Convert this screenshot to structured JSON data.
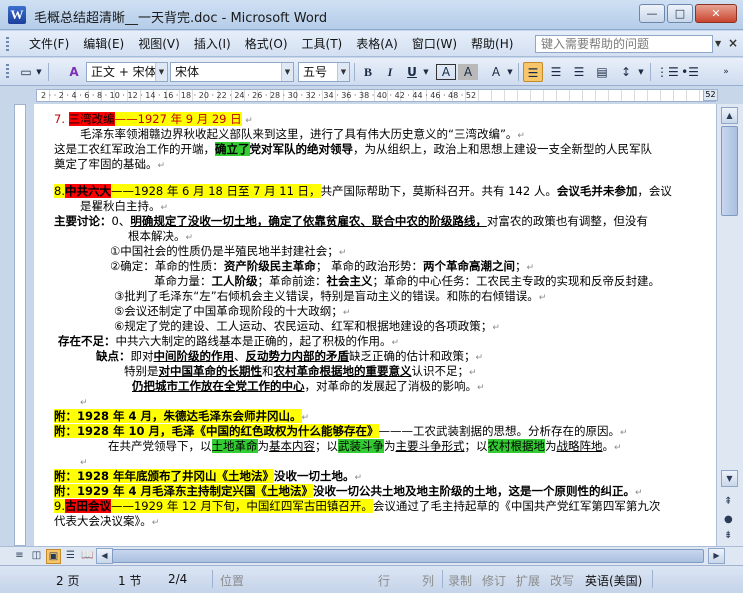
{
  "window": {
    "title": "毛概总结超清晰__一天背完.doc - Microsoft Word",
    "app_icon": "W",
    "minimize": "—",
    "maximize": "□",
    "close": "✕"
  },
  "menu": {
    "items": [
      "文件(F)",
      "编辑(E)",
      "视图(V)",
      "插入(I)",
      "格式(O)",
      "工具(T)",
      "表格(A)",
      "窗口(W)",
      "帮助(H)"
    ],
    "help_placeholder": "键入需要帮助的问题",
    "close_doc": "×"
  },
  "toolbar": {
    "style": "正文 + 宋体",
    "font": "宋体",
    "size": "五号",
    "bold": "B",
    "italic": "I",
    "underline": "U",
    "char_border": "A",
    "char_shade": "A",
    "aa": "A",
    "highlight": "ab"
  },
  "ruler": {
    "numbers": "2 · · 2 · 4 · 6 · 8 · 10 · 12 · 14 · 16 · 18 · 20 · 22 · 24 · 26 · 28 · 30 · 32 · 34 · 36 · 38 · 40 · 42 · 44 · 46 · 48 · 52",
    "end_mark": "52"
  },
  "document": {
    "p7_num": "7.",
    "p7_title": "三湾改编",
    "p7_date": "——1927 年 9 月 29 日",
    "p7_l2": "毛泽东率领湘赣边界秋收起义部队来到这里，进行了具有伟大历史意义的“三湾改编”。",
    "p7_l3a": "这是工农红军政治工作的开端，",
    "p7_l3b": "确立了",
    "p7_l3c": "党对军队的绝对领导",
    "p7_l3d": "，为从组织上，政治上和思想上建设一支全新型的人民军队",
    "p7_l4": "奠定了牢固的基础。",
    "p8_num": "8.",
    "p8_title": "中共六大",
    "p8_date": "——1928 年 6 月 18 日至 7 月 11 日，",
    "p8_rest": "共产国际帮助下，莫斯科召开。共有 142 人。",
    "p8_bold": "会议毛并未参加",
    "p8_end": "，会议",
    "p8_l2": "是瞿秋白主持。",
    "disc_label": "主要讨论：",
    "disc_1a": "0、",
    "disc_1b": "明确规定了没收一切土地，确定了依靠贫雇农、联合中农的阶级路线，",
    "disc_1c": "对富农的政策也有调整，但没有",
    "disc_2": "根本解决。",
    "i1": "①中国社会的性质仍是半殖民地半封建社会；",
    "i2a": "②确定：革命的性质：",
    "i2b": "资产阶级民主革命",
    "i2c": "；  革命的政治形势：",
    "i2d": "两个革命高潮之间",
    "i2e": "；",
    "i3a": "革命力量：",
    "i3b": "工人阶级",
    "i3c": "；革命前途：",
    "i3d": "社会主义",
    "i3e": "；革命的中心任务：工农民主专政的实现和反帝反封建。",
    "i4": "③批判了毛泽东“左”右倾机会主义错误，特别是盲动主义的错误。和陈的右倾错误。",
    "i5": "⑤会议还制定了中国革命现阶段的十大政纲；",
    "i6": "⑥规定了党的建设、工人运动、农民运动、红军和根据地建设的各项政策；",
    "ex_label": "存在不足：",
    "ex_text": "中共六大制定的路线基本是正确的，起了积极的作用。",
    "d_label": "缺点：",
    "d1a": "即对",
    "d1b": "中间阶级的作用",
    "d1c": "、",
    "d1d": "反动势力内部的矛盾",
    "d1e": "缺乏正确的估计和政策；",
    "d2a": "特别是",
    "d2b": "对中国革命的长期性",
    "d2c": "和",
    "d2d": "农村革命根据地的重要意义",
    "d2e": "认识不足；",
    "d3a": "仍把城市工作放在全党工作的中心",
    "d3b": "，对革命的发展起了消极的影响。",
    "a1": "附：1928 年 4 月，朱德达毛泽东会师井冈山。",
    "a2a": "附：1928 年 10 月，毛泽《中国的红色政权为什么能够存在》",
    "a2b": "———工农武装割据的思想。分析存在的原因。",
    "a3a": "在共产党领导下，以",
    "a3b": "土地革命",
    "a3c": "为",
    "a3d": "基本内容",
    "a3e": "；以",
    "a3f": "武装斗争",
    "a3g": "为",
    "a3h": "主要斗争形式",
    "a3i": "；以",
    "a3j": "农村根据地",
    "a3k": "为",
    "a3l": "战略阵地",
    "a3m": "。",
    "a4a": "附：1928 年年底颁布了井冈山《土地法》",
    "a4b": "没收一切土地。",
    "a5a": "附：1929 年 4 月毛泽东主持制定兴国《土地法》",
    "a5b": "没收一切公共土地及地主阶级的土地，这是一个原则性的纠正。",
    "p9_num": "9.",
    "p9_title": "古田会议",
    "p9_date": "——1929 年 12 月下旬，中国红四军古田镇召开。",
    "p9_rest": "会议通过了毛主持起草的《中国共产党红军第四军第九次",
    "p9_l2": "代表大会决议案》。"
  },
  "status": {
    "page": "2 页",
    "section": "1 节",
    "pages": "2/4",
    "position": "位置",
    "line": "行",
    "col": "列",
    "rec": "录制",
    "trk": "修订",
    "ext": "扩展",
    "ovr": "改写",
    "lang": "英语(美国)"
  }
}
